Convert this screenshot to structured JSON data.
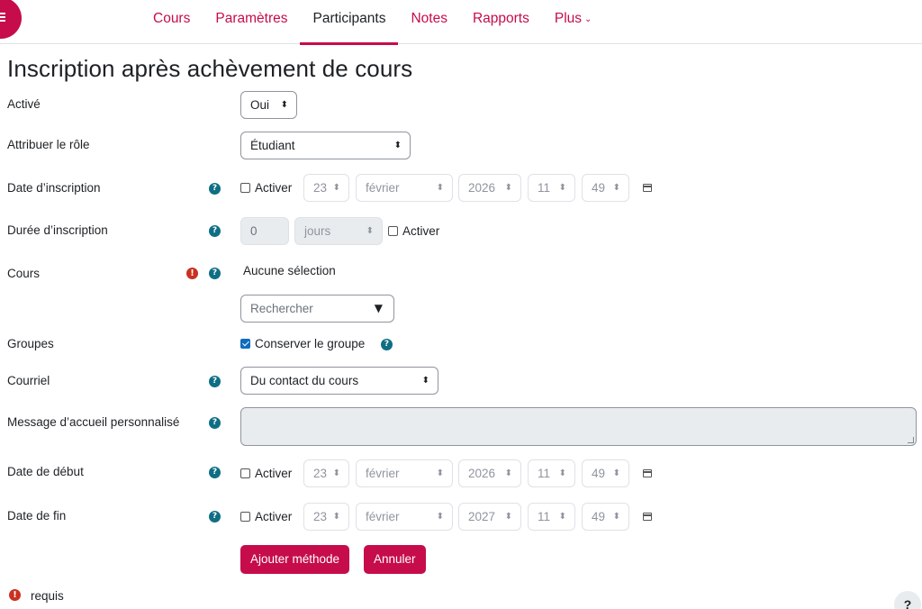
{
  "nav": {
    "menu_icon": "hamburger-icon",
    "tabs": [
      {
        "label": "Cours"
      },
      {
        "label": "Paramètres"
      },
      {
        "label": "Participants"
      },
      {
        "label": "Notes"
      },
      {
        "label": "Rapports"
      },
      {
        "label": "Plus"
      }
    ],
    "active_tab": "Participants",
    "more_chevron": "⌄"
  },
  "page": {
    "title": "Inscription après achèvement de cours"
  },
  "form": {
    "active": {
      "label": "Activé",
      "value": "Oui"
    },
    "role": {
      "label": "Attribuer le rôle",
      "value": "Étudiant"
    },
    "enrol_date": {
      "label": "Date d’inscription",
      "enable_label": "Activer",
      "day": "23",
      "month": "février",
      "year": "2026",
      "hour": "11",
      "minute": "49"
    },
    "duration": {
      "label": "Durée d’inscription",
      "value": "0",
      "unit": "jours",
      "enable_label": "Activer"
    },
    "course": {
      "label": "Cours",
      "selection_text": "Aucune sélection",
      "search_placeholder": "Rechercher"
    },
    "groups": {
      "label": "Groupes",
      "keep_label": "Conserver le groupe",
      "checked": true
    },
    "email": {
      "label": "Courriel",
      "value": "Du contact du cours"
    },
    "welcome": {
      "label": "Message d’accueil personnalisé"
    },
    "start_date": {
      "label": "Date de début",
      "enable_label": "Activer",
      "day": "23",
      "month": "février",
      "year": "2026",
      "hour": "11",
      "minute": "49"
    },
    "end_date": {
      "label": "Date de fin",
      "enable_label": "Activer",
      "day": "23",
      "month": "février",
      "year": "2027",
      "hour": "11",
      "minute": "49"
    },
    "submit_label": "Ajouter méthode",
    "cancel_label": "Annuler",
    "required_text": "requis"
  },
  "help_fab": "?",
  "colors": {
    "brand": "#c60c4b",
    "help": "#0f6e84",
    "required": "#ca3120"
  }
}
